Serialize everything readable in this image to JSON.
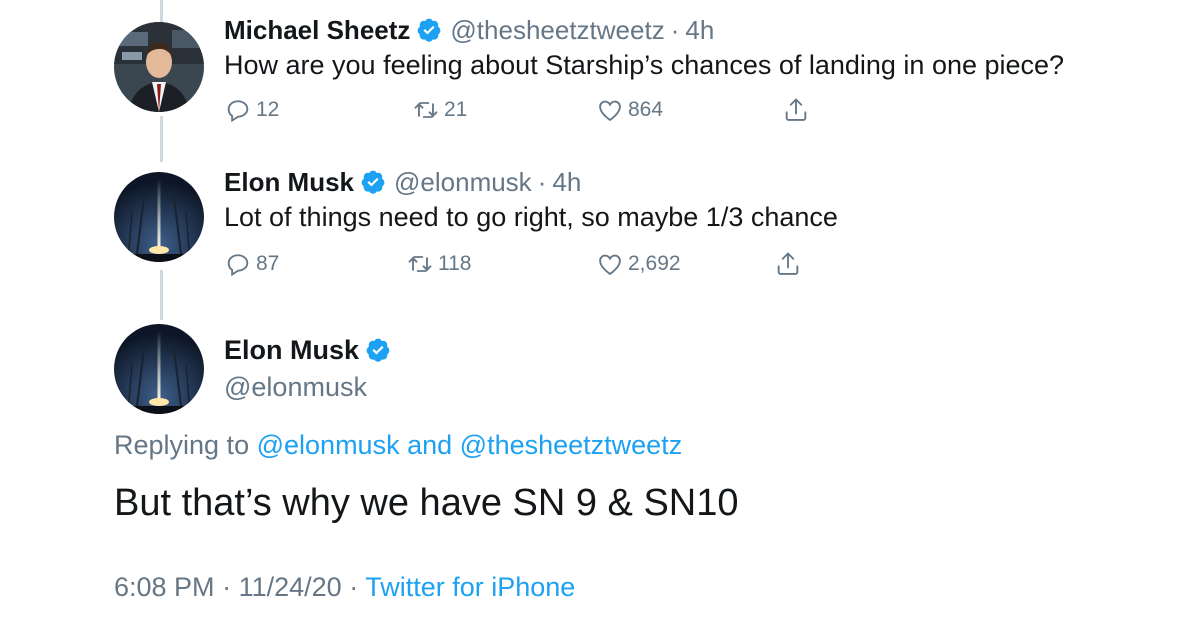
{
  "colors": {
    "text_primary": "#14171a",
    "text_secondary": "#657786",
    "link": "#1da1f2",
    "verified": "#1da1f2",
    "thread_line": "#cfd9de"
  },
  "icons": {
    "verified": "verified-badge-icon",
    "reply": "reply-bubble-icon",
    "retweet": "retweet-icon",
    "like": "heart-icon",
    "share": "share-upload-icon"
  },
  "tweets": [
    {
      "name": "Michael Sheetz",
      "handle": "@thesheetztweetz",
      "dot": "·",
      "time": "4h",
      "text": "How are you feeling about Starship’s chances of landing in one piece?",
      "replies": "12",
      "retweets": "21",
      "likes": "864"
    },
    {
      "name": "Elon Musk",
      "handle": "@elonmusk",
      "dot": "·",
      "time": "4h",
      "text": "Lot of things need to go right, so maybe 1/3 chance",
      "replies": "87",
      "retweets": "118",
      "likes": "2,692"
    }
  ],
  "focused": {
    "name": "Elon Musk",
    "handle": "@elonmusk",
    "replying_prefix": "Replying to",
    "replying_user1": "@elonmusk",
    "replying_and": "and",
    "replying_user2": "@thesheetztweetz",
    "text": "But that’s why we have SN 9 & SN10",
    "time": "6:08 PM",
    "dot1": "·",
    "date": "11/24/20",
    "dot2": "·",
    "source": "Twitter for iPhone"
  }
}
